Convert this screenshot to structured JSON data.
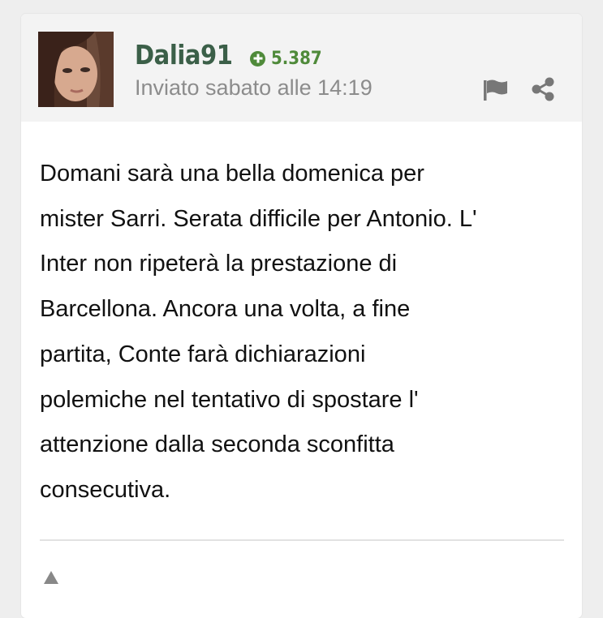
{
  "post": {
    "username": "Dalia91",
    "score": "5.387",
    "sent_label": "Inviato sabato alle 14:19",
    "body": "Domani sarà una bella domenica per\nmister Sarri. Serata difficile per Antonio. L'\nInter non ripeterà la prestazione di\nBarcellona. Ancora una volta, a fine\npartita, Conte farà dichiarazioni\npolemiche nel tentativo di spostare l'\nattenzione dalla seconda sconfitta\nconsecutiva."
  },
  "icons": {
    "score": "plus-circle-icon",
    "report": "flag-icon",
    "share": "share-icon",
    "vote": "triangle-up-icon"
  },
  "colors": {
    "username": "#3b5f48",
    "score": "#4f8a3a",
    "meta_text": "#8c8c8c",
    "header_bg": "#f3f3f3",
    "icon_gray": "#777777"
  }
}
